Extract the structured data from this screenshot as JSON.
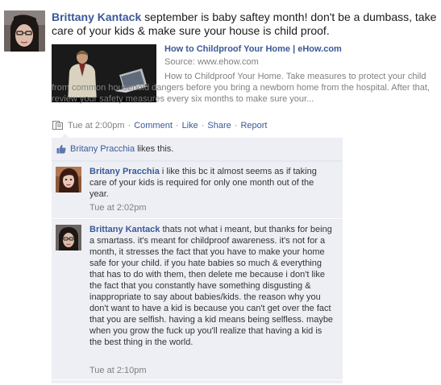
{
  "post": {
    "author": "Brittany Kantack",
    "text": "september is baby saftey month! don't be a dumbass, take care of your kids & make sure your house is child proof.",
    "attachment": {
      "title": "How to Childproof Your Home | eHow.com",
      "source": "Source: www.ehow.com",
      "description": "How to Childproof Your Home. Take measures to protect your child from common household dangers before you bring a newborn home from the hospital. After that, review your safety measures every six months to make sure your...",
      "thumbnail_icon": "video-thumbnail"
    },
    "meta": {
      "icon": "shared-link-icon",
      "timestamp": "Tue at 2:00pm",
      "comment_label": "Comment",
      "like_label": "Like",
      "share_label": "Share",
      "report_label": "Report",
      "separator": "·"
    }
  },
  "likes": {
    "icon": "thumbs-up-icon",
    "name": "Britany Pracchia",
    "text": "likes this."
  },
  "comments": [
    {
      "author": "Britany Pracchia",
      "text": "i like this bc it almost seems as if taking care of your kids is required for only one month out of the year.",
      "timestamp": "Tue at 2:02pm"
    },
    {
      "author": "Brittany Kantack",
      "text": "thats not what i meant, but thanks for being a smartass. it's meant for childproof awareness. it's not for a month, it stresses the fact that you have to make your home safe for your child. if you hate babies so much & everything that has to do with them, then delete me because i don't like the fact that you constantly have something disgusting & inappropriate to say about babies/kids. the reason why you don't want to have a kid is because you can't get over the fact that you are selfish. having a kid means being selfless. maybe when you grow the fuck up you'll realize that having a kid is the best thing in the world.",
      "timestamp": "Tue at 2:10pm"
    }
  ],
  "colors": {
    "link": "#3b5998",
    "muted": "#808080",
    "feedback_bg": "#edeff4"
  }
}
